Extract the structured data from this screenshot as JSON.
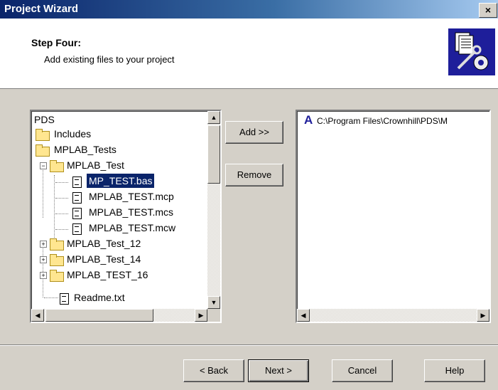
{
  "window": {
    "title": "Project Wizard",
    "close_glyph": "×"
  },
  "header": {
    "step_title": "Step Four:",
    "step_subtitle": "Add existing files to your project",
    "icon": "wizard-tools-icon"
  },
  "tree": {
    "root_label": "PDS",
    "items": [
      {
        "label": "Includes",
        "type": "folder"
      },
      {
        "label": "MPLAB_Tests",
        "type": "folder"
      },
      {
        "label": "MPLAB_Test",
        "type": "folder",
        "expander": "−"
      },
      {
        "label": "MP_TEST.bas",
        "type": "file",
        "selected": true
      },
      {
        "label": "MPLAB_TEST.mcp",
        "type": "file"
      },
      {
        "label": "MPLAB_TEST.mcs",
        "type": "file"
      },
      {
        "label": "MPLAB_TEST.mcw",
        "type": "file"
      },
      {
        "label": "MPLAB_Test_12",
        "type": "folder",
        "expander": "+"
      },
      {
        "label": "MPLAB_Test_14",
        "type": "folder",
        "expander": "+"
      },
      {
        "label": "MPLAB_TEST_16",
        "type": "folder",
        "expander": "+"
      },
      {
        "label": "Readme.txt",
        "type": "file"
      }
    ]
  },
  "buttons": {
    "add": "Add >>",
    "remove": "Remove",
    "back": "< Back",
    "next": "Next >",
    "cancel": "Cancel",
    "help": "Help"
  },
  "file_list": {
    "items": [
      {
        "icon_glyph": "A",
        "path": "C:\\Program Files\\Crownhill\\PDS\\M"
      }
    ]
  },
  "scroll": {
    "up": "▲",
    "down": "▼",
    "left": "◀",
    "right": "▶"
  }
}
